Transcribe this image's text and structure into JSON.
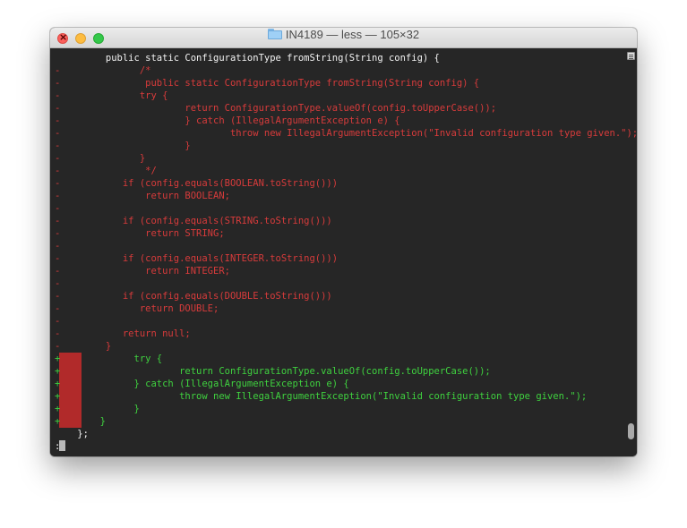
{
  "window": {
    "title": "IN4189 — less — 105×32",
    "title_icon": "folder-icon",
    "controls": [
      "close-button",
      "minimize-button",
      "zoom-button"
    ]
  },
  "colors": {
    "background": "#262626",
    "context_text": "#f2f2f2",
    "deleted_text": "#d73b3b",
    "added_text": "#3fd13f",
    "added_marker_block": "#b12a2a"
  },
  "terminal": {
    "lines": [
      {
        "type": "ctx",
        "text": "         public static ConfigurationType fromString(String config) {"
      },
      {
        "type": "del",
        "text": "-              /*"
      },
      {
        "type": "del",
        "text": "-               public static ConfigurationType fromString(String config) {"
      },
      {
        "type": "del",
        "text": "-              try {"
      },
      {
        "type": "del",
        "text": "-                      return ConfigurationType.valueOf(config.toUpperCase());"
      },
      {
        "type": "del",
        "text": "-                      } catch (IllegalArgumentException e) {"
      },
      {
        "type": "del",
        "text": "-                              throw new IllegalArgumentException(\"Invalid configuration type given.\");"
      },
      {
        "type": "del",
        "text": "-                      }"
      },
      {
        "type": "del",
        "text": "-              }"
      },
      {
        "type": "del",
        "text": "-               */"
      },
      {
        "type": "del",
        "text": "-           if (config.equals(BOOLEAN.toString()))"
      },
      {
        "type": "del",
        "text": "-               return BOOLEAN;"
      },
      {
        "type": "del",
        "text": "-"
      },
      {
        "type": "del",
        "text": "-           if (config.equals(STRING.toString()))"
      },
      {
        "type": "del",
        "text": "-               return STRING;"
      },
      {
        "type": "del",
        "text": "-"
      },
      {
        "type": "del",
        "text": "-           if (config.equals(INTEGER.toString()))"
      },
      {
        "type": "del",
        "text": "-               return INTEGER;"
      },
      {
        "type": "del",
        "text": "-"
      },
      {
        "type": "del",
        "text": "-           if (config.equals(DOUBLE.toString()))"
      },
      {
        "type": "del",
        "text": "-              return DOUBLE;"
      },
      {
        "type": "del",
        "text": "-"
      },
      {
        "type": "del",
        "text": "-           return null;"
      },
      {
        "type": "del",
        "text": "-        }"
      },
      {
        "type": "add",
        "text": "+             try {"
      },
      {
        "type": "add",
        "text": "+                     return ConfigurationType.valueOf(config.toUpperCase());"
      },
      {
        "type": "add",
        "text": "+             } catch (IllegalArgumentException e) {"
      },
      {
        "type": "add",
        "text": "+                     throw new IllegalArgumentException(\"Invalid configuration type given.\");"
      },
      {
        "type": "add",
        "text": "+             }"
      },
      {
        "type": "add",
        "text": "+       }"
      },
      {
        "type": "ctx",
        "text": "    };"
      },
      {
        "type": "ctx",
        "text": ":"
      }
    ]
  },
  "scrollbar": {
    "icon": "scrollback-icon",
    "position_fraction": 0.96
  }
}
